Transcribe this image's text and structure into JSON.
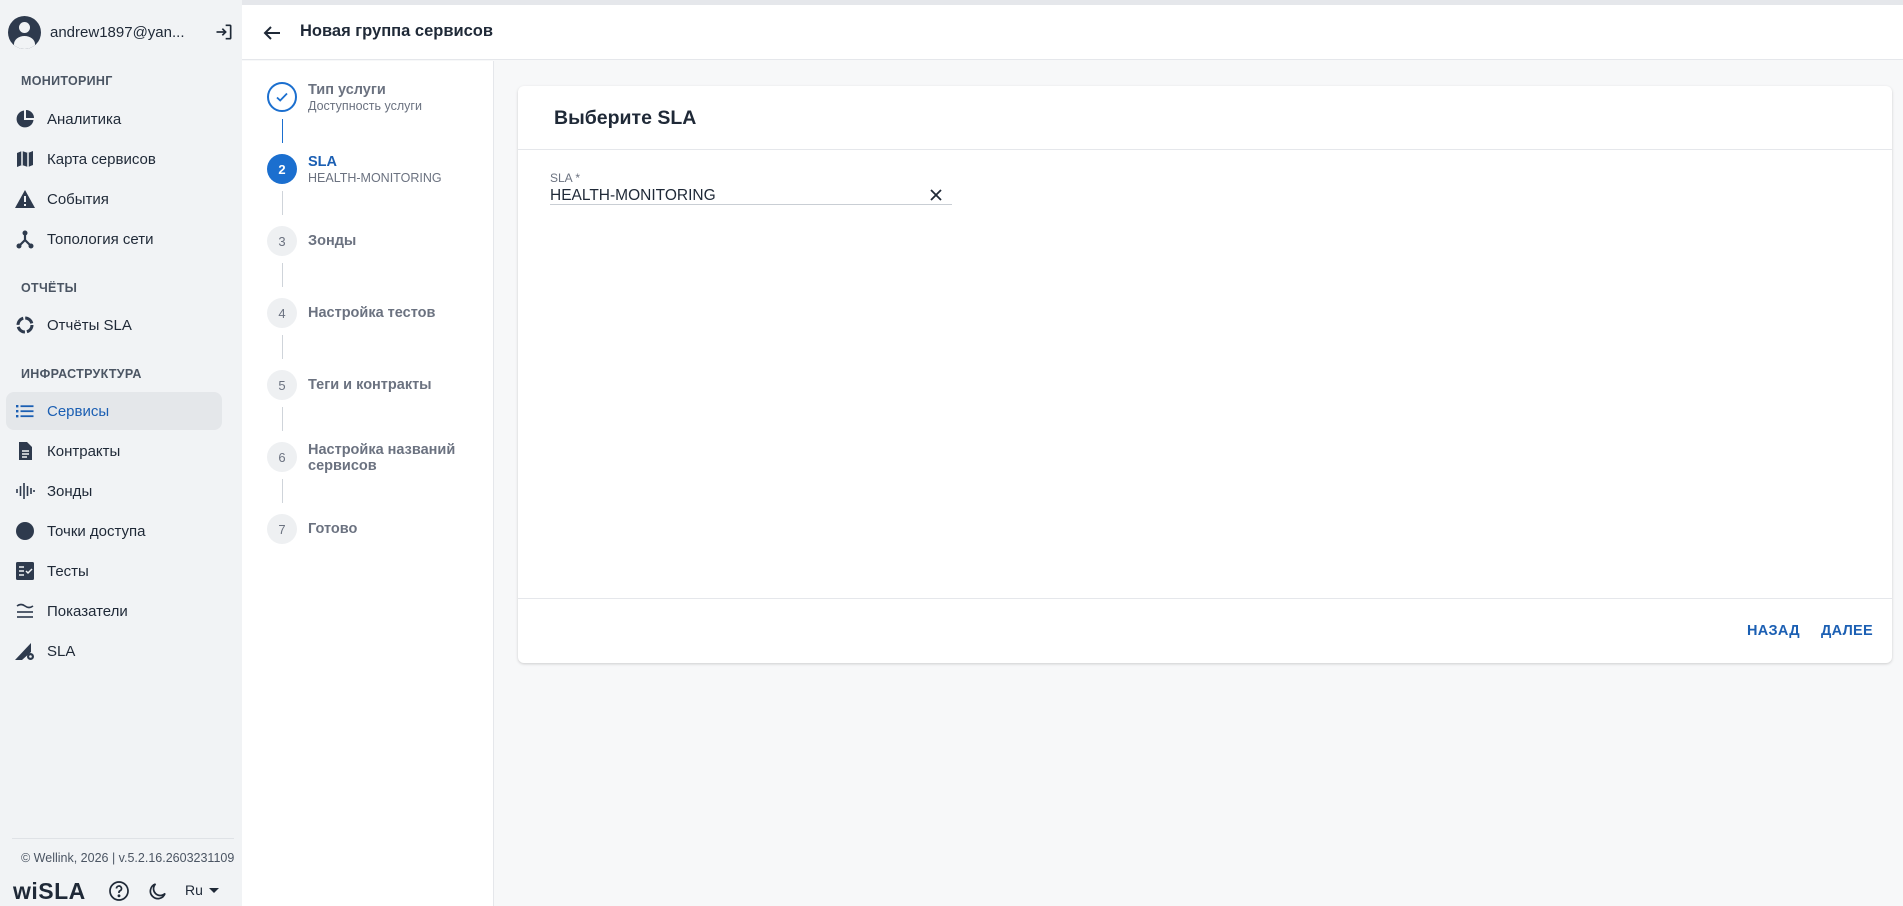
{
  "sidebar": {
    "user_email": "andrew1897@yan...",
    "sections": {
      "monitoring": "МОНИТОРИНГ",
      "reports": "ОТЧЁТЫ",
      "infrastructure": "ИНФРАСТРУКТУРА"
    },
    "items": {
      "analytics": "Аналитика",
      "service_map": "Карта сервисов",
      "events": "События",
      "topology": "Топология сети",
      "sla_reports": "Отчёты SLA",
      "services": "Сервисы",
      "contracts": "Контракты",
      "probes": "Зонды",
      "access_points": "Точки доступа",
      "tests": "Тесты",
      "metrics": "Показатели",
      "sla": "SLA"
    },
    "active_item": "services",
    "copyright": "© Wellink, 2026 | v.5.2.16.2603231109",
    "brand": "wiSLA",
    "language": "Ru"
  },
  "header": {
    "title": "Новая группа сервисов"
  },
  "stepper": {
    "steps": [
      {
        "number": "",
        "label": "Тип услуги",
        "sub": "Доступность услуги",
        "state": "done"
      },
      {
        "number": "2",
        "label": "SLA",
        "sub": "HEALTH-MONITORING",
        "state": "current"
      },
      {
        "number": "3",
        "label": "Зонды",
        "sub": "",
        "state": "pending"
      },
      {
        "number": "4",
        "label": "Настройка тестов",
        "sub": "",
        "state": "pending"
      },
      {
        "number": "5",
        "label": "Теги и контракты",
        "sub": "",
        "state": "pending"
      },
      {
        "number": "6",
        "label_line1": "Настройка названий",
        "label_line2": "сервисов",
        "sub": "",
        "state": "pending"
      },
      {
        "number": "7",
        "label": "Готово",
        "sub": "",
        "state": "pending"
      }
    ]
  },
  "card": {
    "title": "Выберите SLA",
    "sla_field": {
      "label": "SLA *",
      "value": "HEALTH-MONITORING"
    },
    "back_button": "НАЗАД",
    "next_button": "ДАЛЕЕ"
  },
  "colors": {
    "accent": "#1b6fcf",
    "accent_text": "#1b5fb3",
    "sidebar_bg": "#f1f3f5",
    "page_bg": "#f7f8f9"
  }
}
